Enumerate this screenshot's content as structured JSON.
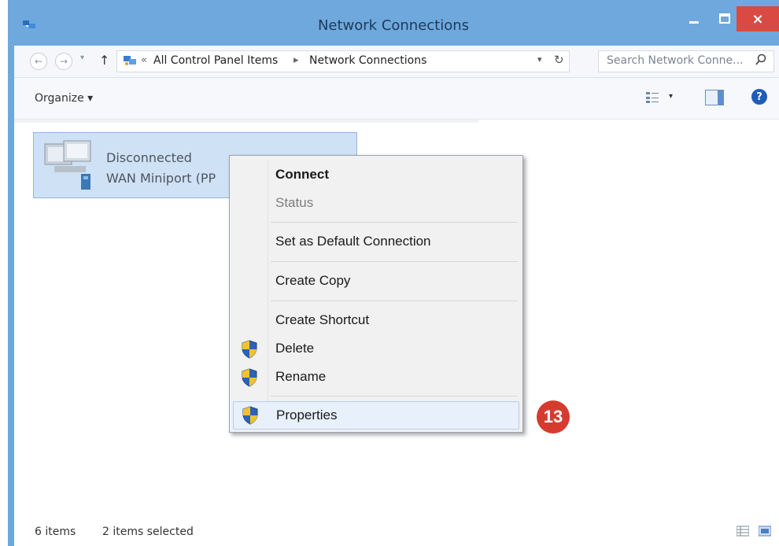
{
  "window": {
    "title": "Network Connections",
    "close_label": "×"
  },
  "address": {
    "sep_label": "«",
    "crumb_1": "All Control Panel Items",
    "crumb_arrow": "▸",
    "crumb_2": "Network Connections"
  },
  "search": {
    "placeholder": "Search Network Conne..."
  },
  "toolbar": {
    "organize_label": "Organize ▾",
    "help_label": "?"
  },
  "connection": {
    "name": "Disconnected",
    "device": "WAN Miniport (PP"
  },
  "context_menu": {
    "items": [
      {
        "label": "Connect"
      },
      {
        "label": "Status"
      },
      {
        "label": "Set as Default Connection"
      },
      {
        "label": "Create Copy"
      },
      {
        "label": "Create Shortcut"
      },
      {
        "label": "Delete"
      },
      {
        "label": "Rename"
      },
      {
        "label": "Properties"
      }
    ]
  },
  "callout": {
    "number": "13"
  },
  "statusbar": {
    "count": "6 items",
    "selected": "2 items selected"
  },
  "colors": {
    "accent": "#d63b2f",
    "titlebar": "#6fa8dc",
    "selection": "#cfe1f5"
  },
  "icons": [
    "app-icon",
    "back-icon",
    "forward-icon",
    "up-icon",
    "refresh-icon",
    "search-icon",
    "shield-icon",
    "help-icon"
  ]
}
